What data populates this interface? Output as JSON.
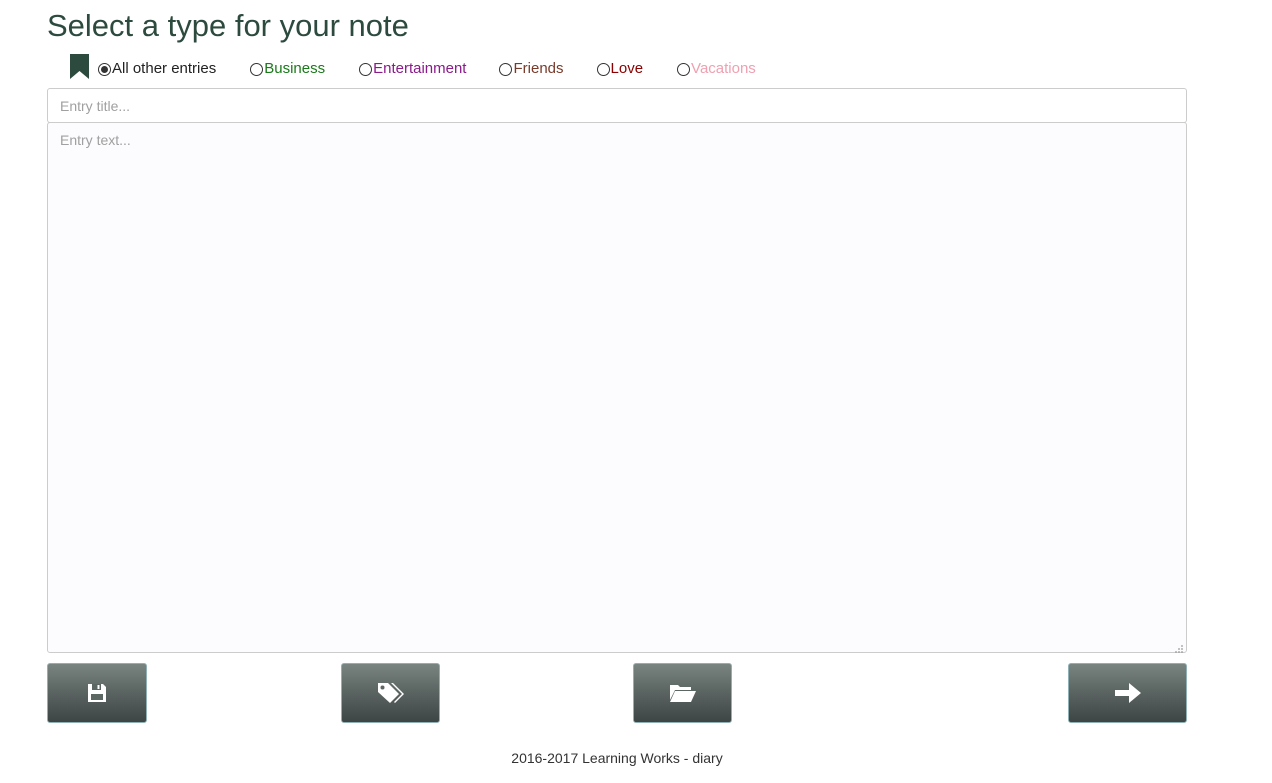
{
  "page": {
    "title": "Select a type for your note"
  },
  "note_types": {
    "icon": "bookmark-icon",
    "options": [
      {
        "label": "All other entries",
        "color": "#222222",
        "checked": true
      },
      {
        "label": "Business",
        "color": "#1a7a1a",
        "checked": false
      },
      {
        "label": "Entertainment",
        "color": "#8b1a8b",
        "checked": false
      },
      {
        "label": "Friends",
        "color": "#7a3a2a",
        "checked": false
      },
      {
        "label": "Love",
        "color": "#8b0000",
        "checked": false
      },
      {
        "label": "Vacations",
        "color": "#f0a0b0",
        "checked": false
      }
    ]
  },
  "editor": {
    "title_placeholder": "Entry title...",
    "title_value": "",
    "text_placeholder": "Entry text...",
    "text_value": ""
  },
  "toolbar": {
    "save_icon": "floppy-disk-icon",
    "tags_icon": "tags-icon",
    "open_icon": "folder-open-icon",
    "next_icon": "arrow-right-icon"
  },
  "colors": {
    "title": "#2d4a3e",
    "bookmark": "#2d4a3e",
    "button_border": "#8fb0b5"
  },
  "footer": {
    "text": "2016-2017 Learning Works - diary"
  }
}
